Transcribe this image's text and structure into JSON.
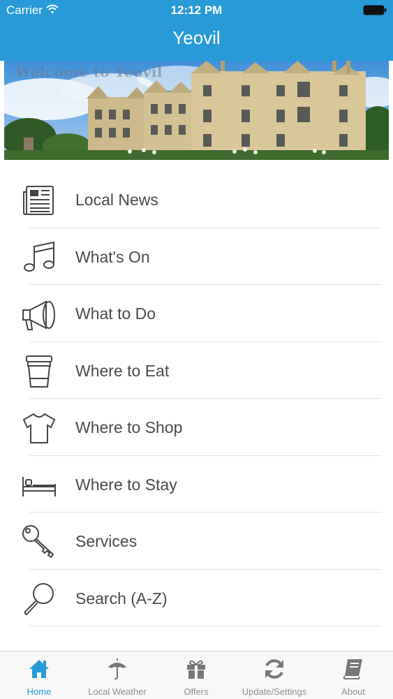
{
  "status_bar": {
    "carrier": "Carrier",
    "time": "12:12 PM"
  },
  "nav": {
    "title": "Yeovil"
  },
  "hero": {
    "caption": "Welcome to Yeovil"
  },
  "menu": [
    {
      "label": "Local News",
      "icon": "newspaper-icon"
    },
    {
      "label": "What's On",
      "icon": "music-note-icon"
    },
    {
      "label": "What to Do",
      "icon": "megaphone-icon"
    },
    {
      "label": "Where to Eat",
      "icon": "coffee-cup-icon"
    },
    {
      "label": "Where to Shop",
      "icon": "tshirt-icon"
    },
    {
      "label": "Where to Stay",
      "icon": "bed-icon"
    },
    {
      "label": "Services",
      "icon": "key-icon"
    },
    {
      "label": "Search (A-Z)",
      "icon": "magnifier-icon"
    }
  ],
  "tabs": [
    {
      "label": "Home",
      "icon": "home-icon",
      "active": true
    },
    {
      "label": "Local Weather",
      "icon": "umbrella-icon"
    },
    {
      "label": "Offers",
      "icon": "gift-icon"
    },
    {
      "label": "Update/Settings",
      "icon": "refresh-icon"
    },
    {
      "label": "About",
      "icon": "book-icon"
    }
  ],
  "colors": {
    "accent": "#279ad7",
    "menu_text": "#4a4a4a",
    "tab_inactive": "#8e8e8e"
  }
}
